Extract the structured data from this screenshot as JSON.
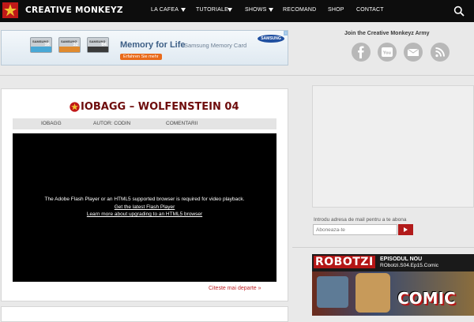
{
  "brand": {
    "name": "CREATIVE MONKEYZ"
  },
  "nav": {
    "items": [
      {
        "label": "LA CAFEA",
        "dropdown": true
      },
      {
        "label": "TUTORIALE",
        "dropdown": true
      },
      {
        "label": "SHOWS",
        "dropdown": true
      },
      {
        "label": "RECOMAND",
        "dropdown": false
      },
      {
        "label": "SHOP",
        "dropdown": false
      },
      {
        "label": "CONTACT",
        "dropdown": false
      }
    ],
    "search_icon": "search-icon"
  },
  "ad": {
    "headline": "Memory for Life",
    "subline": "Samsung Memory Card",
    "cta": "Erfahren Sie mehr",
    "brand": "SAMSUNG",
    "cards": [
      "16",
      "32",
      "64"
    ],
    "card_label": "SAMSUNG"
  },
  "social": {
    "title": "Join the Creative Monkeyz Army",
    "icons": [
      "facebook-icon",
      "youtube-icon",
      "email-icon",
      "rss-icon"
    ]
  },
  "post": {
    "title": "IOBAGG – WOLFENSTEIN 04",
    "meta": {
      "category": "IOBAGG",
      "author": "AUTOR: CODIN",
      "comments": "COMENTARII"
    },
    "player": {
      "message": "The Adobe Flash Player or an HTML5 supported browser is required for video playback.",
      "link1": "Get the latest Flash Player",
      "link2": "Learn more about upgrading to an HTML5 browser"
    },
    "read_more": "Citeste mai departe »"
  },
  "subscribe": {
    "label": "Introdu adresa de mail pentru a te abona",
    "placeholder": "Aboneaza-te"
  },
  "robotzi": {
    "brand": "ROBOTZI",
    "line1": "EPISODUL NOU",
    "line2": "RObotzi.S04.Ep15.Comic",
    "art_text": "COMIC"
  },
  "colors": {
    "accent": "#b21b1b",
    "title": "#6e0c0c",
    "topbar": "#0d0d0d"
  }
}
